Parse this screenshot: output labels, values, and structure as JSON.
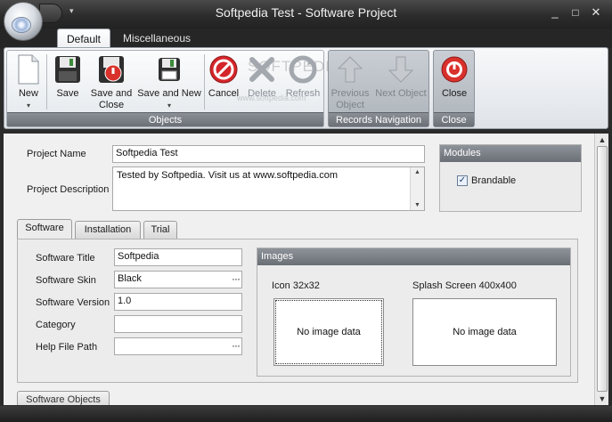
{
  "window": {
    "title": "Softpedia Test - Software Project",
    "minimize": "_",
    "restore": "□",
    "close": "✕",
    "qat_arrow": "▾"
  },
  "ribbon": {
    "tabs": [
      {
        "label": "Default",
        "active": true
      },
      {
        "label": "Miscellaneous",
        "active": false
      }
    ],
    "watermark": "SOFTPEDIA",
    "watermark_url": "www.softpedia.com",
    "groups": {
      "objects": {
        "label": "Objects",
        "buttons": [
          {
            "label": "New",
            "sub": "▾",
            "icon": "new-document-icon"
          },
          {
            "label": "Save",
            "icon": "save-icon"
          },
          {
            "label": "Save and",
            "label2": "Close",
            "icon": "save-and-close-icon"
          },
          {
            "label": "Save and New",
            "sub": "▾",
            "icon": "save-and-new-icon"
          },
          {
            "label": "Cancel",
            "icon": "cancel-icon"
          },
          {
            "label": "Delete",
            "icon": "delete-icon",
            "disabled": true
          },
          {
            "label": "Refresh",
            "icon": "refresh-icon",
            "disabled": true
          }
        ]
      },
      "records_navigation": {
        "label": "Records Navigation",
        "buttons": [
          {
            "label": "Previous",
            "label2": "Object",
            "icon": "arrow-up-icon",
            "disabled": true
          },
          {
            "label": "Next Object",
            "icon": "arrow-down-icon",
            "disabled": true
          }
        ]
      },
      "close": {
        "label": "Close",
        "buttons": [
          {
            "label": "Close",
            "icon": "close-power-icon"
          }
        ]
      }
    }
  },
  "form": {
    "project_name_label": "Project Name",
    "project_name_value": "Softpedia Test",
    "project_description_label": "Project Description",
    "project_description_value": "Tested by Softpedia. Visit us at www.softpedia.com",
    "modules": {
      "title": "Modules",
      "brandable_label": "Brandable",
      "brandable_checked": "✓"
    },
    "subtabs": [
      {
        "label": "Software",
        "active": true
      },
      {
        "label": "Installation",
        "active": false
      },
      {
        "label": "Trial",
        "active": false
      }
    ],
    "software": {
      "title_label": "Software Title",
      "title_value": "Softpedia",
      "skin_label": "Software Skin",
      "skin_value": "Black",
      "version_label": "Software Version",
      "version_value": "1.0",
      "category_label": "Category",
      "category_value": "",
      "help_label": "Help File Path",
      "help_value": "",
      "ellipsis": "···"
    },
    "images": {
      "title": "Images",
      "icon_label": "Icon 32x32",
      "icon_placeholder": "No image data",
      "splash_label": "Splash Screen 400x400",
      "splash_placeholder": "No image data"
    },
    "software_objects_label": "Software Objects"
  },
  "colors": {
    "cancel_red": "#d4262a",
    "close_red": "#d9312b",
    "save_green": "#3d8a3a"
  }
}
